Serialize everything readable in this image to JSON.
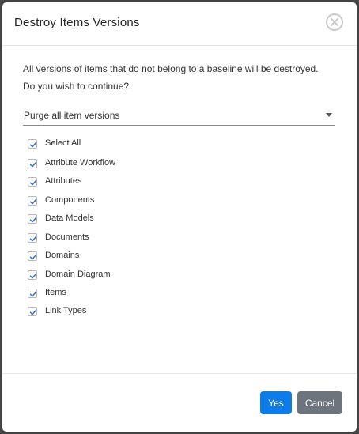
{
  "dialog": {
    "title": "Destroy Items Versions",
    "message_line1": "All versions of items that do not belong to a baseline will be destroyed.",
    "message_line2": "Do you wish to continue?",
    "purge_select": {
      "selected": "Purge all item versions"
    },
    "select_all": {
      "label": "Select All",
      "checked": true
    },
    "items": [
      {
        "label": "Attribute Workflow",
        "checked": true
      },
      {
        "label": "Attributes",
        "checked": true
      },
      {
        "label": "Components",
        "checked": true
      },
      {
        "label": "Data Models",
        "checked": true
      },
      {
        "label": "Documents",
        "checked": true
      },
      {
        "label": "Domains",
        "checked": true
      },
      {
        "label": "Domain Diagram",
        "checked": true
      },
      {
        "label": "Items",
        "checked": true
      },
      {
        "label": "Link Types",
        "checked": true
      }
    ],
    "buttons": {
      "yes_label": "Yes",
      "cancel_label": "Cancel"
    }
  },
  "colors": {
    "primary": "#0d7be8",
    "secondary": "#6c757d",
    "check": "#2a6bd6"
  }
}
